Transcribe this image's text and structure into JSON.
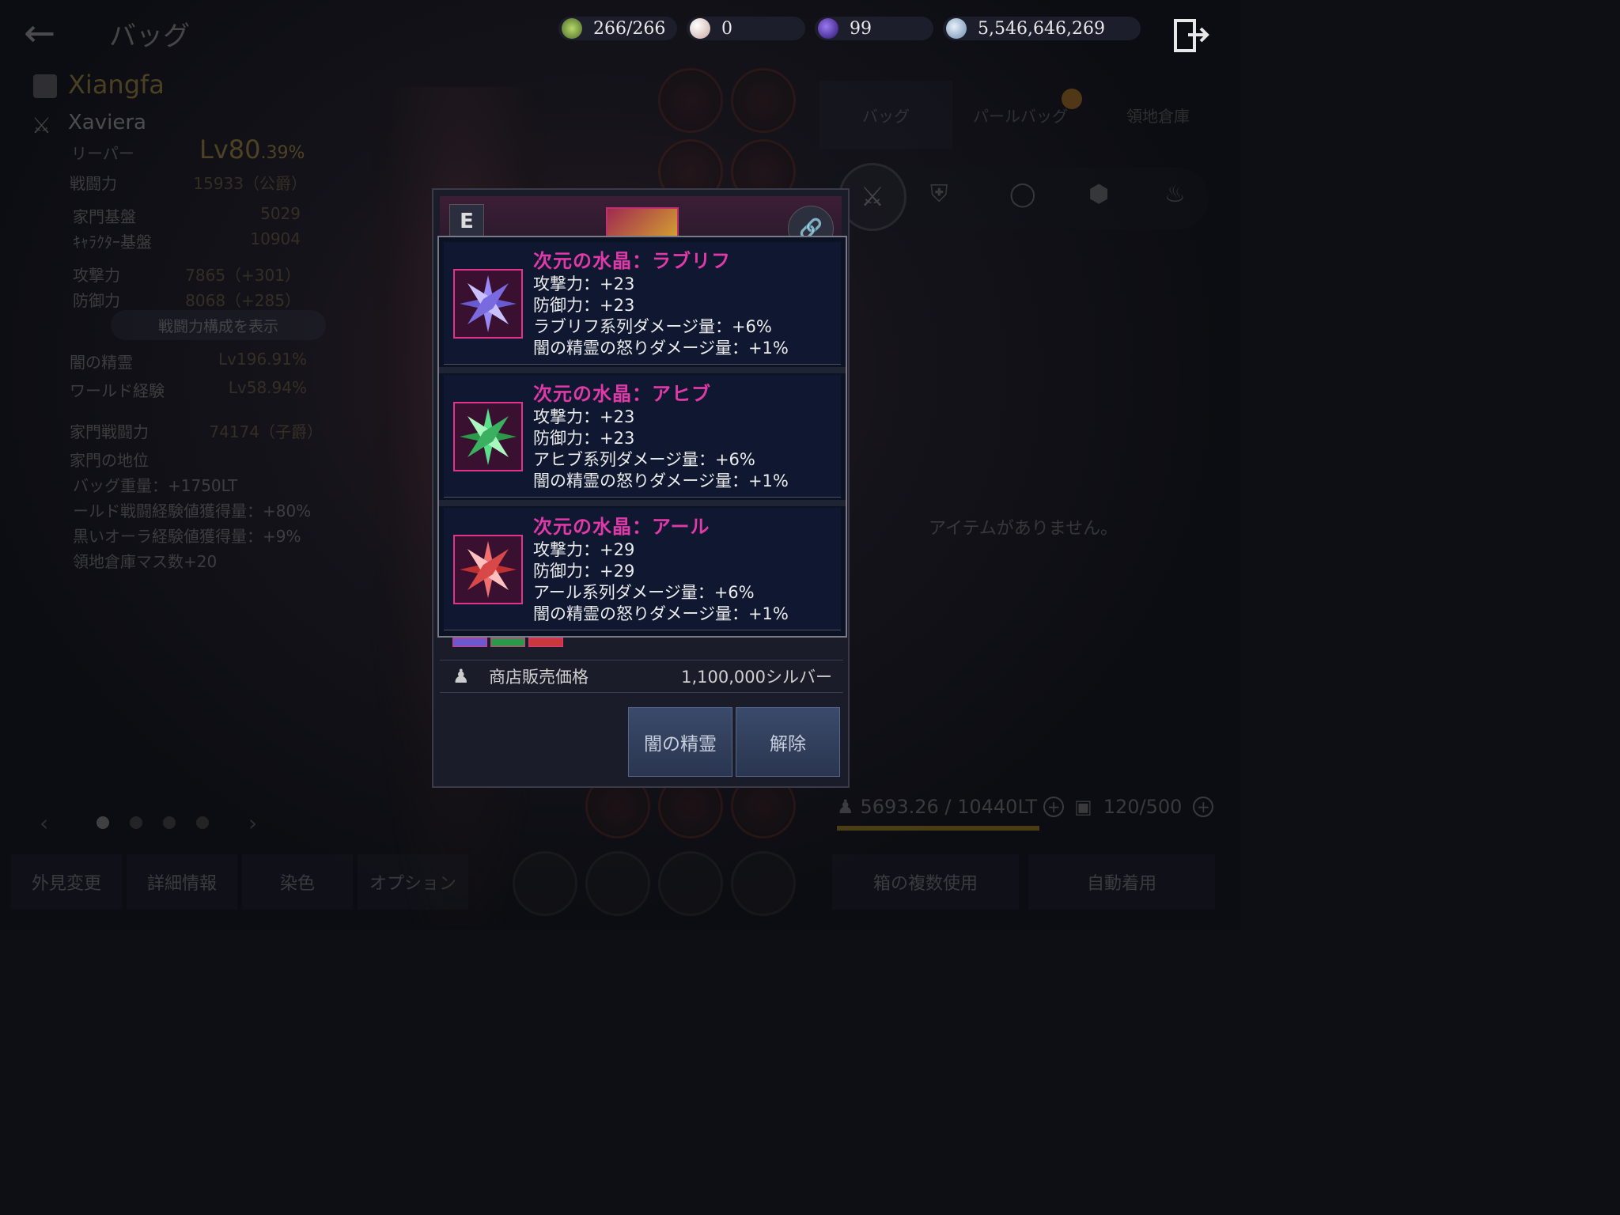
{
  "header": {
    "back_label": "←",
    "title": "バッグ",
    "currencies": [
      {
        "icon": "energy-icon",
        "value": "266/266",
        "color": "#7fa84a"
      },
      {
        "icon": "pearl-icon",
        "value": "0",
        "color": "#e8d8d0"
      },
      {
        "icon": "dark-orb-icon",
        "value": "99",
        "color": "#6a3ad0"
      },
      {
        "icon": "silver-coin-icon",
        "value": "5,546,646,269",
        "color": "#a8c8e8"
      }
    ],
    "exit_icon": "exit-icon"
  },
  "character": {
    "family_name": "Xiangfa",
    "name": "Xaviera",
    "class": "リーパー",
    "level": "Lv80",
    "level_pct": ".39%",
    "combat_power_label": "戦闘力",
    "combat_power_value": "15933（公爵）",
    "family_base_label": "家門基盤",
    "family_base_value": "5029",
    "char_base_label": "ｷｬﾗｸﾀｰ基盤",
    "char_base_value": "10904",
    "attack_label": "攻撃力",
    "attack_value": "7865（+301）",
    "defense_label": "防御力",
    "defense_value": "8068（+285）",
    "show_breakdown_label": "戦闘力構成を表示",
    "dark_spirit_label": "闇の精霊",
    "dark_spirit_value": "Lv196.91%",
    "world_exp_label": "ワールド経験",
    "world_exp_value": "Lv58.94%",
    "family_combat_label": "家門戦闘力",
    "family_combat_value": "74174（子爵）",
    "family_rank_label": "家門の地位",
    "perks": [
      "バッグ重量：+1750LT",
      "ールド戦闘経験値獲得量：+80%",
      "黒いオーラ経験値獲得量：+9%",
      "領地倉庫マス数+20"
    ]
  },
  "bottom_buttons": [
    "外見変更",
    "詳細情報",
    "染色",
    "オプション"
  ],
  "right_panel": {
    "tabs": [
      "バッグ",
      "パールバッグ",
      "領地倉庫"
    ],
    "empty_text": "アイテムがありません。",
    "weight": "5693.26 / 10440LT",
    "slots": "120/500",
    "multi_use_label": "箱の複数使用",
    "auto_equip_label": "自動着用"
  },
  "modal": {
    "grade": "E",
    "crystals": [
      {
        "name": "次元の水晶：ラブリフ",
        "icon": "purple-crystal-icon",
        "color": "#8a7af0",
        "stats": [
          "攻撃力：+23",
          "防御力：+23",
          "ラブリフ系列ダメージ量：+6%",
          "闇の精霊の怒りダメージ量：+1%"
        ]
      },
      {
        "name": "次元の水晶：アヒブ",
        "icon": "green-crystal-icon",
        "color": "#3ac86a",
        "stats": [
          "攻撃力：+23",
          "防御力：+23",
          "アヒブ系列ダメージ量：+6%",
          "闇の精霊の怒りダメージ量：+1%"
        ]
      },
      {
        "name": "次元の水晶：アール",
        "icon": "red-crystal-icon",
        "color": "#e84a4a",
        "stats": [
          "攻撃力：+29",
          "防御力：+29",
          "アール系列ダメージ量：+6%",
          "闇の精霊の怒りダメージ量：+1%"
        ]
      }
    ],
    "price_label": "商店販売価格",
    "price_value": "1,100,000シルバー",
    "dark_spirit_button": "闇の精霊",
    "release_button": "解除"
  }
}
